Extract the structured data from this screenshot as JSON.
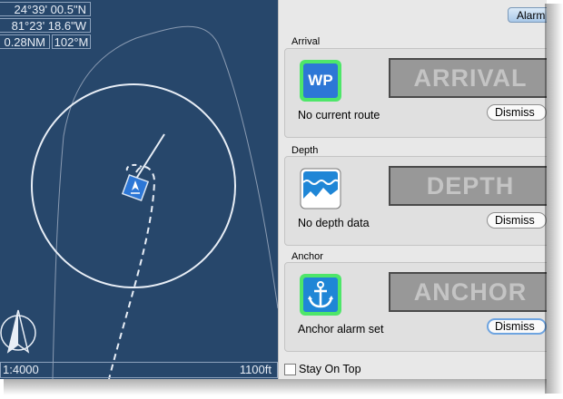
{
  "chart": {
    "latitude": "24°39' 00.5\"N",
    "longitude": "81°23' 18.6\"W",
    "distance": "0.28NM",
    "bearing": "102°M",
    "scale_ratio": "1:4000",
    "scale_distance": "1100ft"
  },
  "panel": {
    "tab_label": "Alarm",
    "arrival": {
      "title": "Arrival",
      "icon_label": "WP",
      "display": "ARRIVAL",
      "status": "No current route",
      "dismiss_label": "Dismiss"
    },
    "depth": {
      "title": "Depth",
      "display": "DEPTH",
      "status": "No depth data",
      "dismiss_label": "Dismiss"
    },
    "anchor": {
      "title": "Anchor",
      "display": "ANCHOR",
      "status": "Anchor alarm set",
      "dismiss_label": "Dismiss"
    },
    "stay_on_top_label": "Stay On Top",
    "stay_on_top_checked": false
  },
  "colors": {
    "chart_water": "#27476b",
    "icon_highlight": "#4ee66a",
    "display_bg": "#989898"
  }
}
